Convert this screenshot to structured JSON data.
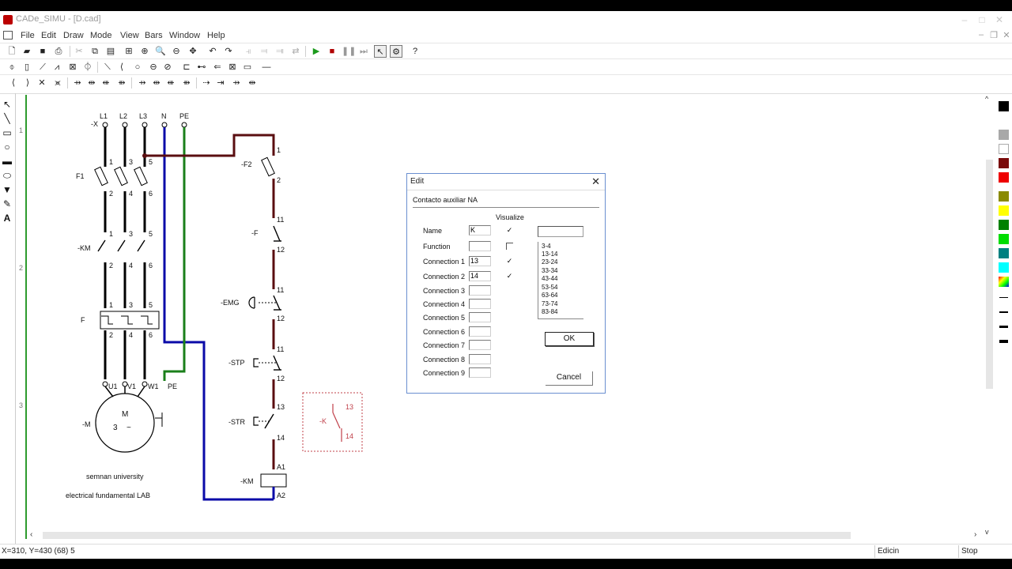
{
  "window": {
    "title": "CADe_SIMU - [D.cad]"
  },
  "menu": [
    "File",
    "Edit",
    "Draw",
    "Mode",
    "View",
    "Bars",
    "Window",
    "Help"
  ],
  "rows": [
    "1",
    "2",
    "3"
  ],
  "schematic": {
    "power_supply": {
      "ref": "-X",
      "terminals": [
        "L1",
        "L2",
        "L3",
        "N",
        "PE"
      ]
    },
    "fuses": {
      "ref": "F1",
      "pins_top": [
        "1",
        "3",
        "5"
      ],
      "pins_bottom": [
        "2",
        "4",
        "6"
      ]
    },
    "contactor": {
      "ref": "-KM",
      "pins_top": [
        "1",
        "3",
        "5"
      ],
      "pins_bottom": [
        "2",
        "4",
        "6"
      ]
    },
    "relay": {
      "ref": "F",
      "pins_top": [
        "1",
        "3",
        "5"
      ],
      "pins_bottom": [
        "2",
        "4",
        "6"
      ]
    },
    "motor": {
      "ref": "-M",
      "terminals": [
        "U1",
        "V1",
        "W1",
        "PE"
      ],
      "symbol_m": "M",
      "symbol_3": "3",
      "symbol_ac": "~"
    },
    "control_fuse": {
      "ref": "-F2",
      "pin_top": "1",
      "pin_bottom": "2"
    },
    "thermal_contact": {
      "ref": "-F",
      "pin_top": "11",
      "pin_bottom": "12"
    },
    "emergency": {
      "ref": "-EMG",
      "pin_top": "11",
      "pin_bottom": "12"
    },
    "stop": {
      "ref": "-STP",
      "pin_top": "11",
      "pin_bottom": "12"
    },
    "start": {
      "ref": "-STR",
      "pin_top": "13",
      "pin_bottom": "14"
    },
    "coil": {
      "ref": "-KM",
      "pin_top": "A1",
      "pin_bottom": "A2"
    },
    "new_contact": {
      "ref": "-K",
      "pin_top": "13",
      "pin_bottom": "14"
    },
    "notes": [
      "semnan university",
      "electrical fundamental LAB"
    ]
  },
  "dialog": {
    "title": "Edit",
    "description": "Contacto auxiliar NA",
    "visualize_header": "Visualize",
    "name": {
      "label": "Name",
      "value": "K",
      "visible": true
    },
    "function": {
      "label": "Function",
      "value": "",
      "visible": false
    },
    "connections": [
      {
        "label": "Connection 1",
        "value": "13",
        "visible": true
      },
      {
        "label": "Connection 2",
        "value": "14",
        "visible": true
      },
      {
        "label": "Connection 3",
        "value": ""
      },
      {
        "label": "Connection 4",
        "value": ""
      },
      {
        "label": "Connection 5",
        "value": ""
      },
      {
        "label": "Connection 6",
        "value": ""
      },
      {
        "label": "Connection 7",
        "value": ""
      },
      {
        "label": "Connection 8",
        "value": ""
      },
      {
        "label": "Connection 9",
        "value": ""
      }
    ],
    "pair_input": "",
    "pair_options": [
      "3-4",
      "13-14",
      "23-24",
      "33-34",
      "43-44",
      "53-54",
      "63-64",
      "73-74",
      "83-84"
    ],
    "ok": "OK",
    "cancel": "Cancel"
  },
  "status": {
    "coords": "X=310, Y=430 (68) 5",
    "mode": "Edicin",
    "sim": "Stop"
  },
  "colors": {
    "wire_power": "#000000",
    "wire_control": "#5a0e10",
    "wire_neutral": "#0a0aa8",
    "wire_pe": "#1a7f1a",
    "new_element": "#c0404a",
    "palette": [
      "#000000",
      "#a8a8a8",
      "#ffffff",
      "#7a0a0a",
      "#ee0000",
      "#8a8a00",
      "#ffff00",
      "#008000",
      "#00dd00",
      "#008080",
      "#00ffff"
    ]
  }
}
